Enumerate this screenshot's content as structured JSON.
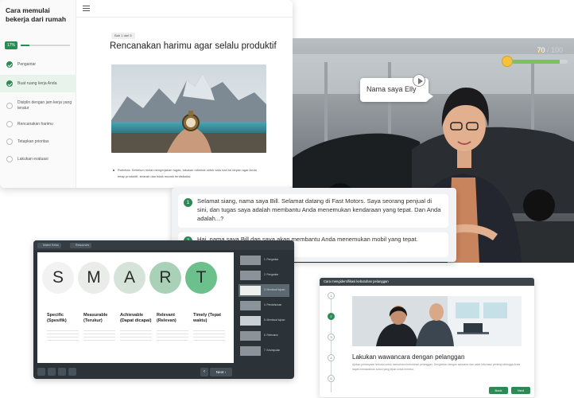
{
  "colors": {
    "brand_green": "#2c8a55",
    "dark_panel": "#2c3338",
    "score_star": "#e8b93a"
  },
  "course_page": {
    "course_title": "Cara memulai bekerja dari rumah",
    "progress_label": "17%",
    "progress_percent": 17,
    "menu_icon": "hamburger-menu-icon",
    "lessons": [
      {
        "label": "Pengantar",
        "status": "done",
        "icon": "check-circle-icon"
      },
      {
        "label": "Buat ruang kerja Anda",
        "status": "done",
        "icon": "check-circle-icon"
      },
      {
        "label": "Disiplin dengan jam kerja yang teratur",
        "status": "todo",
        "icon": "circle-icon"
      },
      {
        "label": "Rencanakan harimu",
        "status": "todo",
        "icon": "circle-icon"
      },
      {
        "label": "Tetapkan prioritas",
        "status": "todo",
        "icon": "circle-icon"
      },
      {
        "label": "Lakukan evaluasi",
        "status": "todo",
        "icon": "circle-icon"
      }
    ],
    "breadcrumb": "Bab 1 dari 5",
    "page_title": "Rencanakan harimu agar selalu produktif",
    "bullet_text": "Rutinitas. Sebelum mulai mengerjakan tugas, lakukan rutinitas untuk satu hari ke depan agar Anda tetap produktif, terarah dan tidak mudah terdistraksi."
  },
  "video_scene": {
    "score": "70",
    "score_max": "/ 100",
    "score_icon": "star-icon",
    "mood_icon": "smiley-face-icon",
    "mood_level": 0.85,
    "speech": "Nama saya Elly",
    "play_icon": "play-icon"
  },
  "dialogue": {
    "options": [
      {
        "number": "1",
        "text": "Selamat siang, nama saya Bill. Selamat datang di Fast Motors. Saya seorang penjual di sini, dan tugas saya adalah membantu Anda menemukan kendaraan yang tepat. Dan Anda adalah...?"
      },
      {
        "number": "2",
        "text": "Hai, nama saya Bill dan saya akan membantu Anda menemukan mobil yang tepat."
      }
    ]
  },
  "smart_slide": {
    "tabs": [
      "Materi Kelas",
      "Resources"
    ],
    "letters": [
      "S",
      "M",
      "A",
      "R",
      "T"
    ],
    "columns": [
      {
        "title": "Specific (Spesifik)"
      },
      {
        "title": "Measurable (Terukur)"
      },
      {
        "title": "Achievable (Dapat dicapai)"
      },
      {
        "title": "Relevant (Relevan)"
      },
      {
        "title": "Timely (Tepat waktu)"
      }
    ],
    "thumbnails": [
      "1. Pengantar",
      "2. Pengantar",
      "3. Membuat tujuan",
      "4. Pendahuluan",
      "5. Membuat tujuan",
      "6. Relevansi",
      "7. Kesimpulan"
    ],
    "next_label": "Next",
    "prev_icon": "chevron-left-icon"
  },
  "interview_card": {
    "header": "Cara mengidentifikasi kebutuhan pelanggan",
    "steps": [
      "1",
      "2",
      "3",
      "4",
      "5"
    ],
    "title": "Lakukan wawancara dengan pelanggan",
    "body": "Ajukan pertanyaan terbuka untuk memahami kebutuhan pelanggan. Dengarkan dengan saksama dan catat informasi penting sehingga Anda dapat menawarkan solusi yang tepat untuk mereka.",
    "back_label": "Back",
    "next_label": "Next"
  }
}
